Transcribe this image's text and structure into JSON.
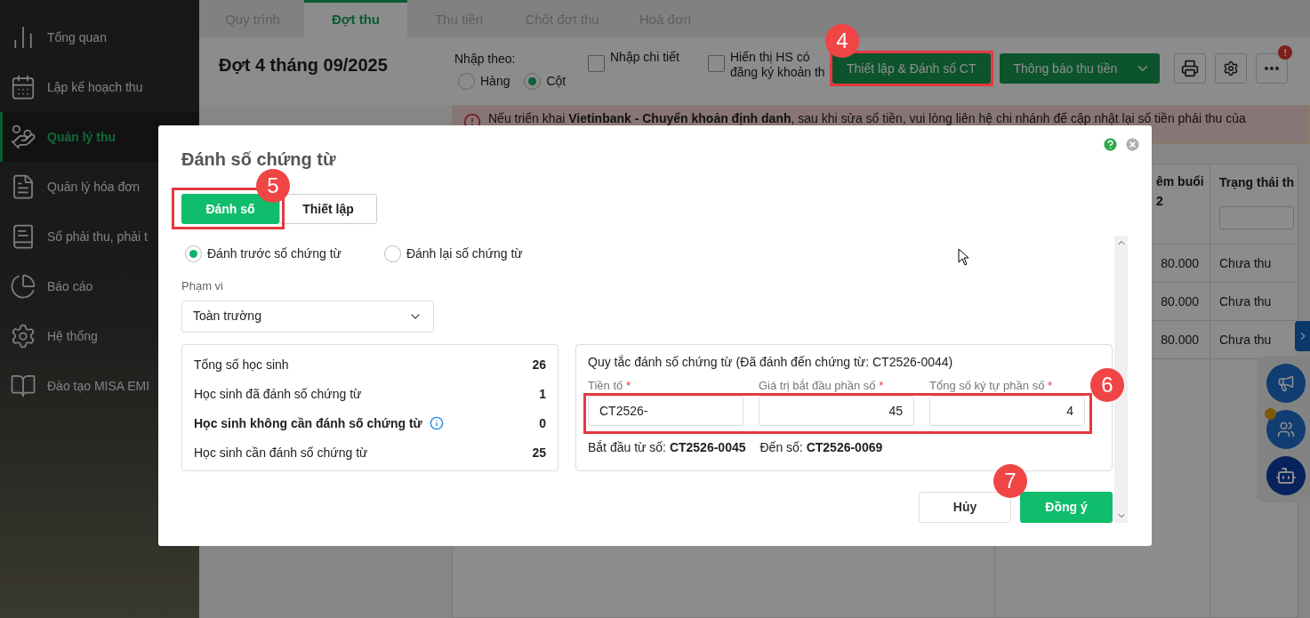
{
  "sidebar": {
    "items": [
      {
        "label": "Tổng quan",
        "selected": false
      },
      {
        "label": "Lập kế hoạch thu",
        "selected": false
      },
      {
        "label": "Quản lý thu",
        "selected": true
      },
      {
        "label": "Quản lý hóa đơn",
        "selected": false
      },
      {
        "label": "Sổ phải thu, phải t",
        "selected": false
      },
      {
        "label": "Báo cáo",
        "selected": false
      },
      {
        "label": "Hệ thống",
        "selected": false
      },
      {
        "label": "Đào tạo MISA EMI",
        "selected": false
      }
    ]
  },
  "tabs": [
    {
      "label": "Quy trình",
      "selected": false
    },
    {
      "label": "Đợt thu",
      "selected": true
    },
    {
      "label": "Thu tiền",
      "selected": false
    },
    {
      "label": "Chốt đợt thu",
      "selected": false
    },
    {
      "label": "Hoá đơn",
      "selected": false
    }
  ],
  "header": {
    "title": "Đợt 4 tháng 09/2025",
    "input_mode": {
      "label": "Nhập theo:",
      "options": [
        {
          "label": "Hàng",
          "selected": false
        },
        {
          "label": "Cột",
          "selected": true
        }
      ]
    },
    "checkboxes": [
      {
        "label": "Nhập chi tiết",
        "checked": false
      },
      {
        "label": "Hiển thị HS có đăng ký khoản th",
        "checked": false
      }
    ],
    "setup_button": {
      "label": "Thiết lập & Đánh số CT",
      "callout": "4"
    },
    "notify_button": {
      "label": "Thông báo thu tiền"
    },
    "more_alert": "!"
  },
  "banner": {
    "text": "Nếu triển khai **Vietinbank - Chuyển khoản định danh**, sau khi sửa số tiền, vui lòng liên hệ chi nhánh để cập nhật lại số tiền phải thu của"
  },
  "table": {
    "columns": [
      "êm buổi 2",
      "Trạng thái th"
    ],
    "rows": [
      [
        "80.000",
        "Chưa thu"
      ],
      [
        "80.000",
        "Chưa thu"
      ],
      [
        "80.000",
        "Chưa thu"
      ]
    ]
  },
  "dialog": {
    "title": "Đánh số chứng từ",
    "tabs": [
      {
        "label": "Đánh số",
        "selected": true
      },
      {
        "label": "Thiết lập",
        "selected": false
      }
    ],
    "tabs_callout": "5",
    "modes": [
      {
        "label": "Đánh trước số chứng từ",
        "selected": true
      },
      {
        "label": "Đánh lại số chứng từ",
        "selected": false
      }
    ],
    "scope": {
      "label": "Phạm vi",
      "value": "Toàn trường"
    },
    "stats": [
      {
        "label": "Tổng số học sinh",
        "value": "26",
        "bold": false,
        "info": false
      },
      {
        "label": "Học sinh đã đánh số chứng từ",
        "value": "1",
        "bold": false,
        "info": false
      },
      {
        "label": "Học sinh không cần đánh số chứng từ",
        "value": "0",
        "bold": true,
        "info": true
      },
      {
        "label": "Học sinh cần đánh số chứng từ",
        "value": "25",
        "bold": false,
        "info": false
      }
    ],
    "rule": {
      "title": "Quy tắc đánh số chứng từ (Đã đánh đến chứng từ: CT2526-0044)",
      "fields": [
        {
          "label": "Tiền tố",
          "value": "CT2526-",
          "kind": "text"
        },
        {
          "label": "Giá trị bắt đầu phần số",
          "value": "45",
          "kind": "number"
        },
        {
          "label": "Tổng số ký tự phần số",
          "value": "4",
          "kind": "number"
        }
      ],
      "required_mark": "*",
      "callout": "6",
      "summary": [
        "Bắt đầu từ số: **CT2526-0045**",
        "Đến số: **CT2526-0069**"
      ]
    },
    "buttons": [
      {
        "label": "Hủy",
        "kind": "secondary"
      },
      {
        "label": "Đồng ý",
        "kind": "primary"
      }
    ],
    "buttons_callout": "7"
  }
}
